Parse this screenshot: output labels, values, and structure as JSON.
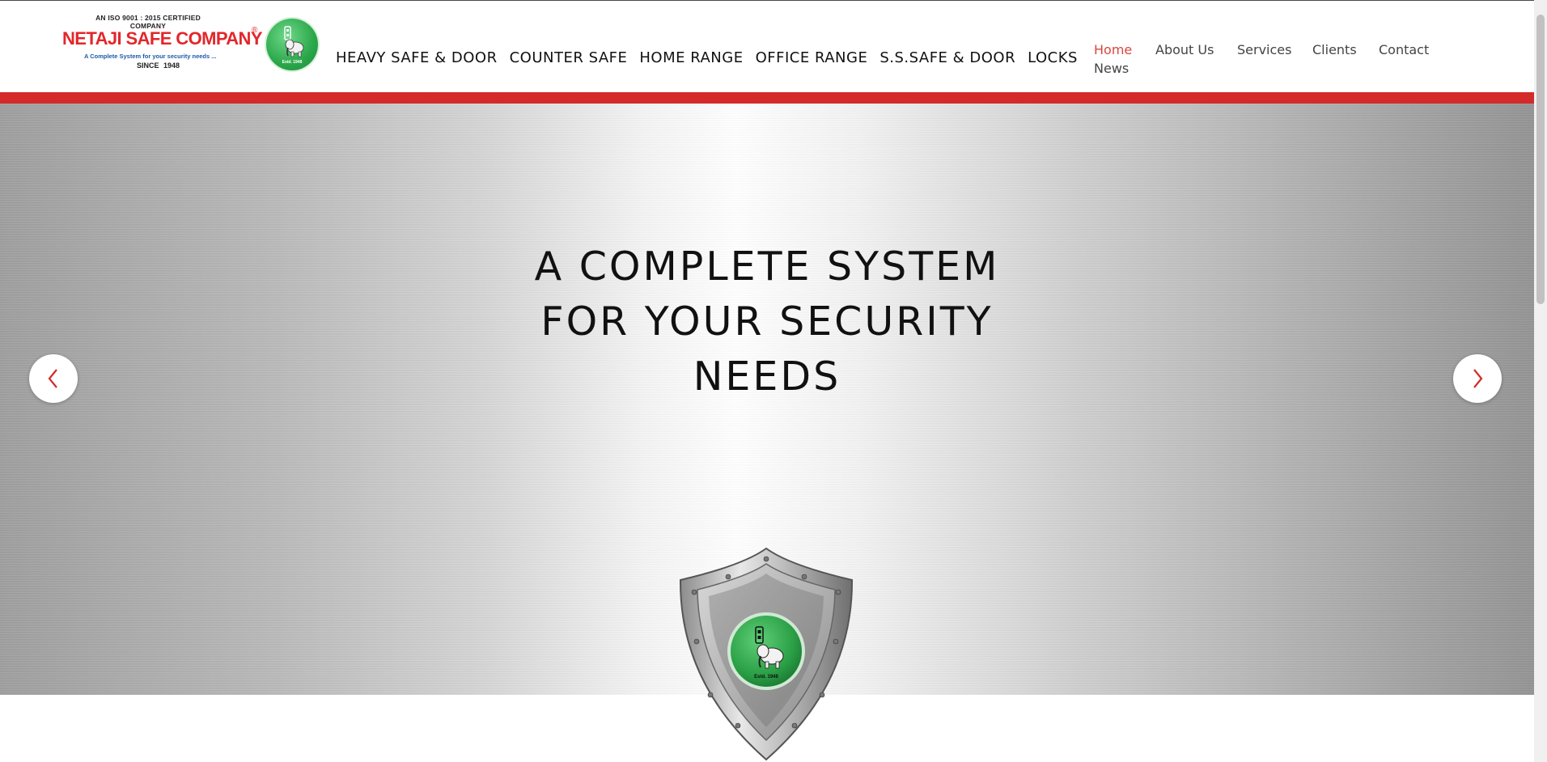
{
  "logo": {
    "iso_text": "AN ISO 9001 : 2015 CERTIFIED COMPANY",
    "brand": "NETAJI SAFE COMPANY",
    "registered": "®",
    "tagline": "A Complete System for your security needs ...",
    "since": "SINCE 1948",
    "badge_text": "Estd. 1948"
  },
  "main_nav": [
    "HEAVY SAFE & DOOR",
    "COUNTER SAFE",
    "HOME RANGE",
    "OFFICE RANGE",
    "S.S.SAFE & DOOR",
    "LOCKS"
  ],
  "sub_nav": {
    "home": "Home",
    "about": "About Us",
    "services": "Services",
    "clients": "Clients",
    "contact": "Contact",
    "news": "News"
  },
  "hero": {
    "line1": "A COMPLETE SYSTEM",
    "line2": "FOR YOUR SECURITY",
    "line3": "NEEDS"
  },
  "colors": {
    "accent_red": "#d42a2a",
    "brand_red": "#e3262b",
    "badge_green": "#2aa74a",
    "active_nav": "#d9473f"
  },
  "icons": {
    "prev": "chevron-left-icon",
    "next": "chevron-right-icon"
  }
}
